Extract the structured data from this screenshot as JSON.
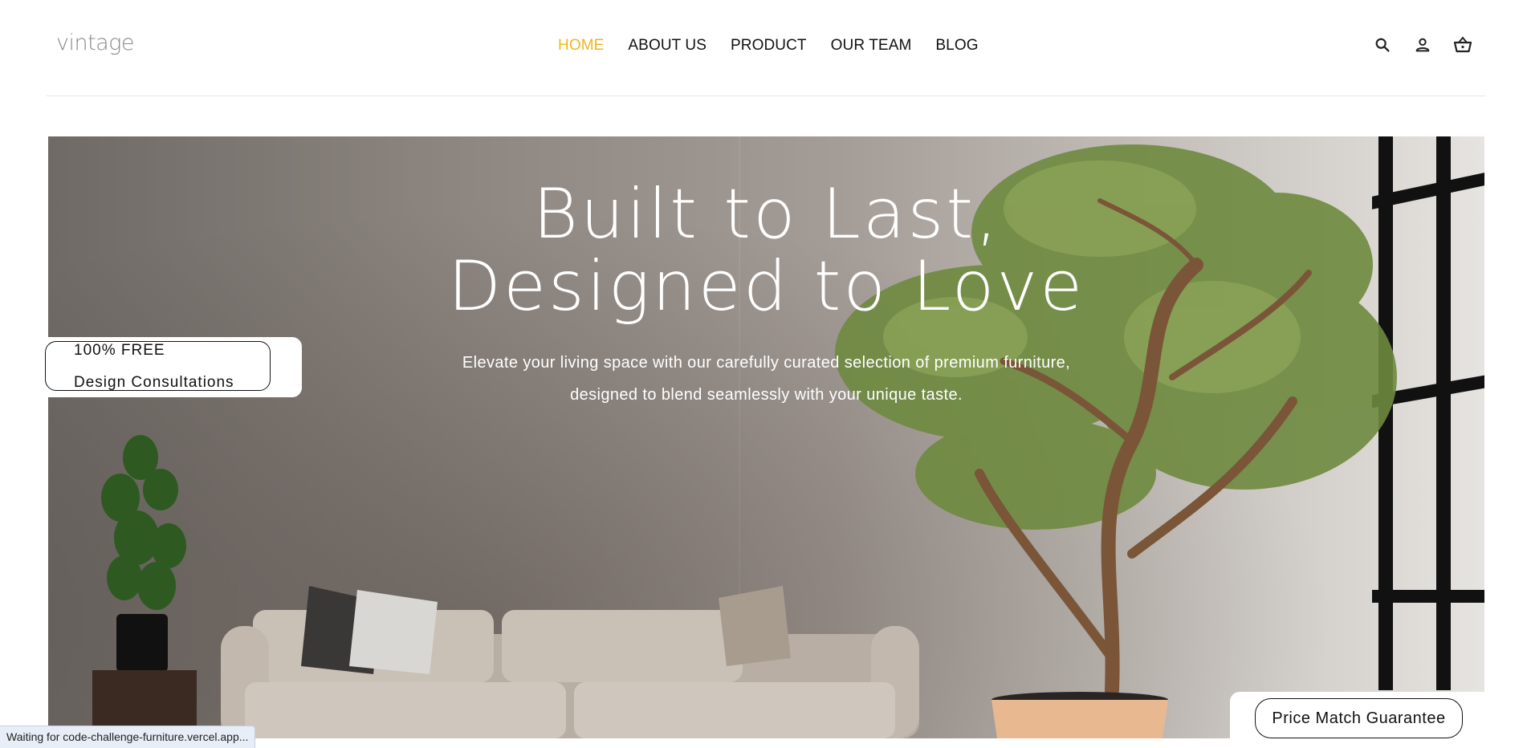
{
  "header": {
    "logo": "vintage",
    "nav": [
      {
        "label": "HOME",
        "active": true
      },
      {
        "label": "ABOUT US",
        "active": false
      },
      {
        "label": "PRODUCT",
        "active": false
      },
      {
        "label": "OUR TEAM",
        "active": false
      },
      {
        "label": "BLOG",
        "active": false
      }
    ],
    "icons": [
      "search-icon",
      "user-icon",
      "cart-icon"
    ],
    "active_color": "#f2b51d"
  },
  "hero": {
    "title_line1": "Built to Last,",
    "title_line2": "Designed to Love",
    "subtitle_line1": "Elevate your living space with our carefully curated selection of premium furniture,",
    "subtitle_line2": "designed to blend seamlessly with your unique taste."
  },
  "badge": {
    "line1": "100% FREE",
    "line2": "Design Consultations"
  },
  "price_match": {
    "label": "Price Match Guarantee"
  },
  "browser_status": {
    "text": "Waiting for code-challenge-furniture.vercel.app..."
  }
}
